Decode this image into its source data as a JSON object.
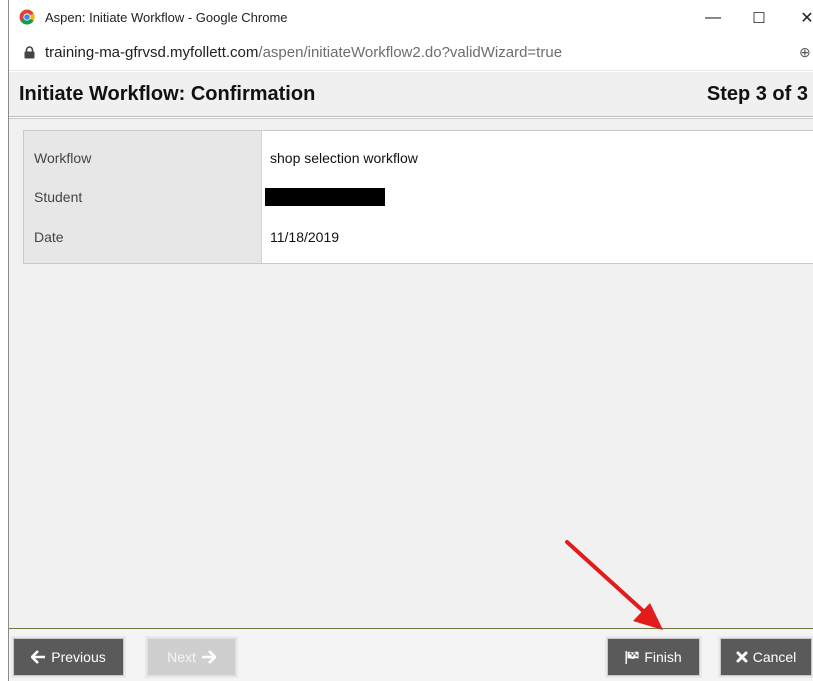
{
  "window": {
    "title": "Aspen: Initiate Workflow - Google Chrome",
    "minimize_glyph": "—",
    "maximize_glyph": "☐",
    "close_glyph": "✕"
  },
  "address": {
    "url_host": "training-ma-gfrvsd.myfollett.com",
    "url_path": "/aspen/initiateWorkflow2.do?validWizard=true",
    "zoom_glyph": "⊕"
  },
  "page": {
    "title": "Initiate Workflow: Confirmation",
    "step": "Step 3 of 3"
  },
  "details": [
    {
      "label": "Workflow",
      "value": "shop selection workflow"
    },
    {
      "label": "Student",
      "value": ""
    },
    {
      "label": "Date",
      "value": "11/18/2019"
    }
  ],
  "buttons": {
    "previous": "Previous",
    "next": "Next",
    "finish": "Finish",
    "cancel": "Cancel"
  },
  "colors": {
    "annotation_arrow": "#e31b1b",
    "button_bg": "#5a5a5a",
    "button_disabled_bg": "#cfcfcf"
  },
  "icons": {
    "browser": "chrome-logo-icon",
    "lock": "lock-icon",
    "previous": "arrow-left-icon",
    "next": "arrow-right-icon",
    "finish": "checkered-flag-icon",
    "cancel": "x-icon"
  }
}
